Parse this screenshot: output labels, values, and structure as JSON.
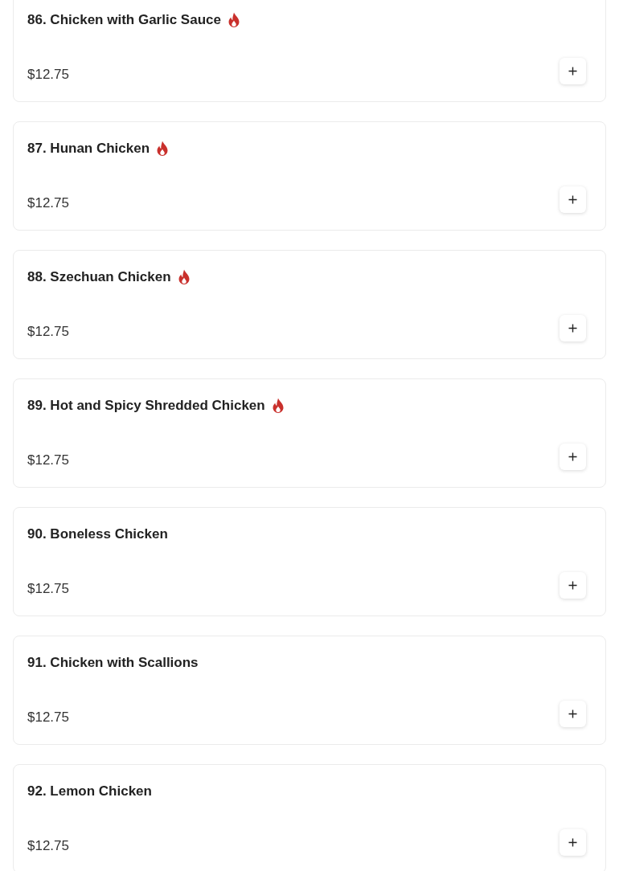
{
  "items": [
    {
      "name": "86. Chicken with Garlic Sauce",
      "spicy": true,
      "price": "$12.75"
    },
    {
      "name": "87. Hunan Chicken",
      "spicy": true,
      "price": "$12.75"
    },
    {
      "name": "88. Szechuan Chicken",
      "spicy": true,
      "price": "$12.75"
    },
    {
      "name": "89. Hot and Spicy Shredded Chicken",
      "spicy": true,
      "price": "$12.75"
    },
    {
      "name": "90. Boneless Chicken",
      "spicy": false,
      "price": "$12.75"
    },
    {
      "name": "91. Chicken with Scallions",
      "spicy": false,
      "price": "$12.75"
    },
    {
      "name": "92. Lemon Chicken",
      "spicy": false,
      "price": "$12.75"
    }
  ]
}
